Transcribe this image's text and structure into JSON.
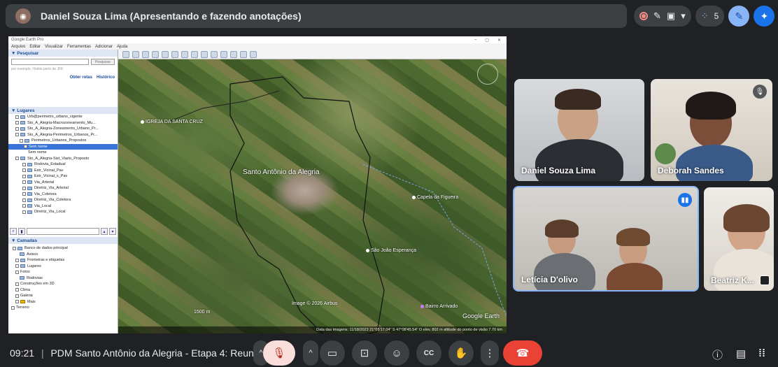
{
  "presenter_bar": {
    "title": "Daniel Souza Lima (Apresentando e fazendo anotações)",
    "participant_count": "5"
  },
  "google_earth": {
    "window_title": "Google Earth Pro",
    "window_controls": [
      "–",
      "▢",
      "✕"
    ],
    "menu": [
      "Arquivo",
      "Editar",
      "Visualizar",
      "Ferramentas",
      "Adicionar",
      "Ajuda"
    ],
    "search": {
      "header": "▼ Pesquisar",
      "button": "Pesquisar",
      "hint": "por exemplo, Hotéis perto de JFK",
      "links": [
        "Obter rotas",
        "Histórico"
      ]
    },
    "places": {
      "header": "▼ Lugares",
      "items": [
        "Urb@perimetro_urbano_vigente",
        "Sto_A_Alegria-Macrozoneamento_Mu...",
        "Sto_A_Alegria-Zoneamento_Urbano_Pr...",
        "Sto_A_Alegria-Perimetros_Urbanos_Pr...",
        "Perimetros_Urbanos_Propostos",
        "Sem nome",
        "Sem nome",
        "Sto_A_Alegria-Sist_Viario_Proposto",
        "Rodovia_Estadual",
        "Estr_Vicinal_Pav",
        "Estr_Vicinal_s_Pav",
        "Via_Arterial",
        "Diretriz_Via_Arterial",
        "Via_Coletora",
        "Diretriz_Via_Coletora",
        "Via_Local",
        "Diretriz_Via_Local"
      ]
    },
    "layers": {
      "header": "▼ Camadas",
      "items": [
        "Banco de dados principal",
        "Avisos",
        "Fronteiras e etiquetas",
        "Lugares",
        "Fotos",
        "Rodovias",
        "Construções em 3D",
        "Clima",
        "Galeria",
        "Mais",
        "Terreno"
      ]
    },
    "map": {
      "labels": {
        "city": "Santo Antônio da Alegria",
        "igreja": "IGREJA DA SANTA CRUZ",
        "capela": "Capela da Figueira",
        "sao_joao": "São João Esperança",
        "bairro": "Bairro Arrivado",
        "image_credit": "Image © 2026 Airbus",
        "logo": "Google Earth",
        "scale": "1500 m"
      },
      "status": "Data das imagens: 11/18/2023   21°05'17.04\" S   47°08'45.54\" O   elev. 802 m   altitude do ponto de visão   7.70 km"
    }
  },
  "participants": [
    {
      "name": "Daniel Souza Lima",
      "muted": false
    },
    {
      "name": "Deborah Sandes",
      "muted": true
    },
    {
      "name": "Letícia D'olivo",
      "speaking": true
    },
    {
      "name": "Beatriz K...",
      "muted": false
    }
  ],
  "bottom_bar": {
    "time": "09:21",
    "separator": "|",
    "meeting_title": "PDM Santo Antônio da Alegria - Etapa 4: Reuniã..."
  },
  "icons": {
    "chevron_up": "^",
    "mic_off": "🎙",
    "camera": "▭",
    "present": "⊡",
    "emoji": "☺",
    "captions": "CC",
    "raise_hand": "✋",
    "more": "⋮",
    "end_call": "☎",
    "info": "ⓘ",
    "chat": "▤",
    "activities": "⁞⁞"
  },
  "colors": {
    "background": "#202124",
    "end_call": "#ea4335",
    "mic_off_bg": "#f9dedc",
    "accent_blue": "#1a73e8"
  }
}
